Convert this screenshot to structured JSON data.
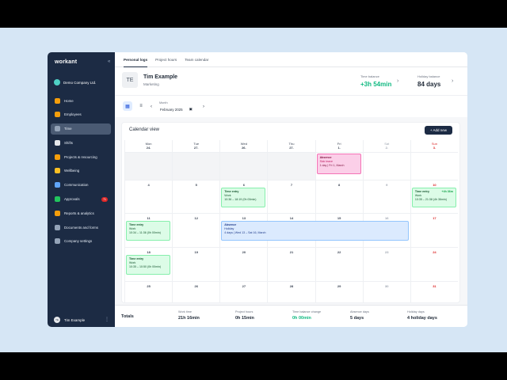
{
  "sidebar": {
    "logo": "workant",
    "collapse_icon": "«",
    "company": "Demo Company Ltd.",
    "items": [
      {
        "label": "Home",
        "icon": "home-icon",
        "color": "#f59e0b",
        "active": false
      },
      {
        "label": "Employees",
        "icon": "employees-icon",
        "color": "#f59e0b",
        "active": false
      },
      {
        "label": "Time",
        "icon": "clock-icon",
        "color": "#94a3b8",
        "active": true
      },
      {
        "label": "Shifts",
        "icon": "shifts-icon",
        "color": "#e5e7eb",
        "active": false
      },
      {
        "label": "Projects & resourcing",
        "icon": "projects-icon",
        "color": "#f59e0b",
        "active": false
      },
      {
        "label": "Wellbeing",
        "icon": "smile-icon",
        "color": "#fbbf24",
        "active": false
      },
      {
        "label": "Communication",
        "icon": "globe-icon",
        "color": "#60a5fa",
        "active": false
      },
      {
        "label": "Approvals",
        "icon": "check-icon",
        "color": "#22c55e",
        "active": false,
        "badge": "71"
      },
      {
        "label": "Reports & analytics",
        "icon": "chart-icon",
        "color": "#f59e0b",
        "active": false
      },
      {
        "label": "Documents and forms",
        "icon": "document-icon",
        "color": "#94a3b8",
        "active": false
      },
      {
        "label": "Company settings",
        "icon": "gear-icon",
        "color": "#94a3b8",
        "active": false
      }
    ],
    "user": {
      "initials": "TE",
      "name": "Tim Example",
      "more": "⋮"
    }
  },
  "tabs": [
    "Personal logs",
    "Project hours",
    "Team calendar"
  ],
  "profile": {
    "initials": "TE",
    "name": "Tim Example",
    "role": "Marketing",
    "time_balance_label": "Time balance",
    "time_balance": "+3h 54min",
    "holiday_balance_label": "Holiday balance",
    "holiday_balance": "84 days"
  },
  "toolbar": {
    "month_label": "Month",
    "month_value": "February 2025",
    "prev": "‹",
    "next": "›"
  },
  "calendar": {
    "title": "Calendar view",
    "add_label": "+ Add new",
    "headers": [
      {
        "day": "Mon",
        "date": "24."
      },
      {
        "day": "Tue",
        "date": "27."
      },
      {
        "day": "Wed",
        "date": "26."
      },
      {
        "day": "Thu",
        "date": "27."
      },
      {
        "day": "Fri",
        "date": "1."
      },
      {
        "day": "Sat",
        "date": "2."
      },
      {
        "day": "Sun",
        "date": "3."
      }
    ],
    "weeks": [
      [
        "",
        "",
        "",
        "",
        "",
        "",
        ""
      ],
      [
        "4",
        "5",
        "6",
        "7",
        "8",
        "9",
        "10"
      ],
      [
        "11",
        "12",
        "13",
        "14",
        "15",
        "16",
        "17"
      ],
      [
        "18",
        "19",
        "20",
        "21",
        "22",
        "23",
        "24"
      ],
      [
        "25",
        "26",
        "27",
        "28",
        "29",
        "30",
        "31"
      ]
    ],
    "events": {
      "absence1": {
        "title": "Absence",
        "type": "Sick leave",
        "detail": "1 day | Fri 1, March"
      },
      "entry_wed": {
        "title": "Time entry",
        "type": "Work",
        "detail": "10:36 – 18:19 (0h 00min)"
      },
      "entry_sun": {
        "title": "Time entry",
        "plus": "+4h 36m",
        "type": "Work",
        "detail": "10:35 – 21:38 (4h 36min)"
      },
      "entry_mon11": {
        "title": "Time entry",
        "type": "Work",
        "detail": "10:34 – 11:36 (0h 00min)"
      },
      "absence2": {
        "title": "Absence",
        "type": "Holiday",
        "detail": "4 days | Wed 13 – Sat 16, March"
      },
      "entry_mon18": {
        "title": "Time entry",
        "type": "Work",
        "detail": "10:35 – 10:50 (0h 00min)"
      }
    }
  },
  "totals": {
    "title": "Totals",
    "items": [
      {
        "label": "Work time",
        "value": "21h 16min"
      },
      {
        "label": "Project hours",
        "value": "0h 15min"
      },
      {
        "label": "Time balance change",
        "value": "0h 00min"
      },
      {
        "label": "Absence days",
        "value": "5 days"
      },
      {
        "label": "Holiday days",
        "value": "4 holiday days"
      }
    ]
  }
}
